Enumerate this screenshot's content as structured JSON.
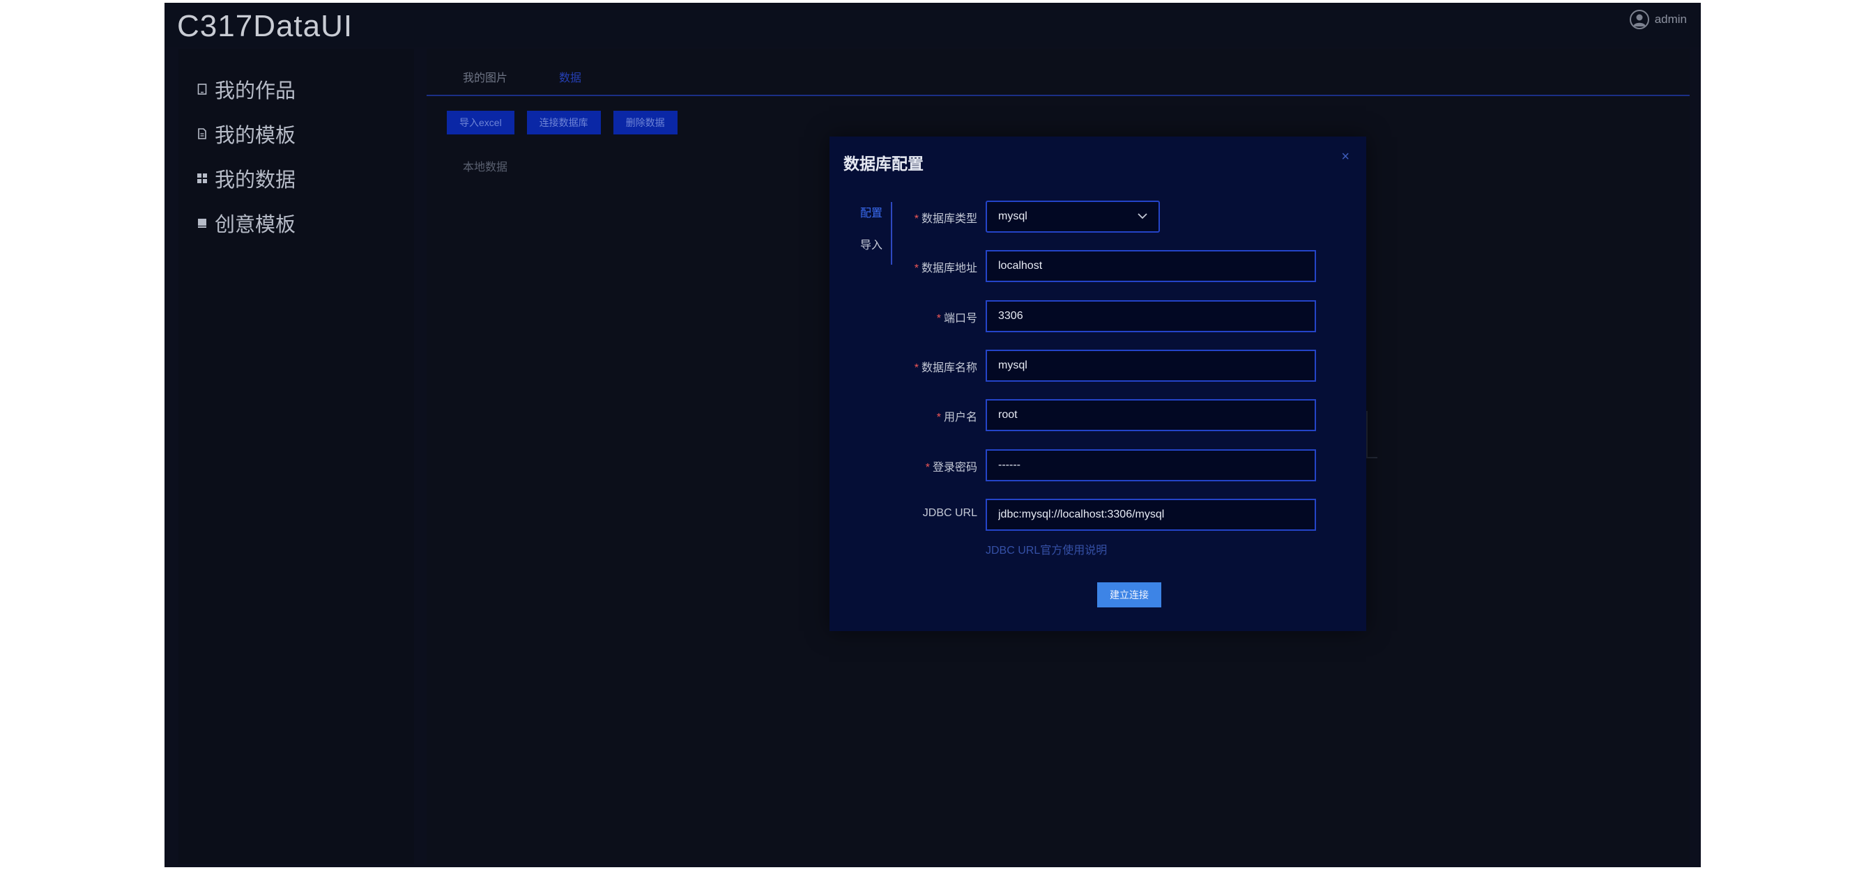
{
  "app": {
    "title": "C317DataUI",
    "user_name": "admin"
  },
  "sidebar": {
    "items": [
      {
        "label": "我的作品",
        "icon": "tablet-icon"
      },
      {
        "label": "我的模板",
        "icon": "document-icon"
      },
      {
        "label": "我的数据",
        "icon": "grid-icon"
      },
      {
        "label": "创意模板",
        "icon": "square-icon"
      }
    ]
  },
  "main": {
    "tabs": [
      {
        "label": "我的图片"
      },
      {
        "label": "数据",
        "active": true
      }
    ],
    "toolbar": {
      "import_excel": "导入excel",
      "connect_db": "连接数据库",
      "delete_data": "删除数据"
    },
    "local_data_label": "本地数据"
  },
  "modal": {
    "title": "数据库配置",
    "close": "×",
    "side_tabs": [
      {
        "label": "配置",
        "active": true
      },
      {
        "label": "导入"
      }
    ],
    "fields": {
      "db_type": {
        "label": "数据库类型",
        "value": "mysql"
      },
      "db_address": {
        "label": "数据库地址",
        "value": "localhost"
      },
      "port": {
        "label": "端口号",
        "value": "3306"
      },
      "db_name": {
        "label": "数据库名称",
        "value": "mysql"
      },
      "username": {
        "label": "用户名",
        "value": "root"
      },
      "password": {
        "label": "登录密码",
        "value": "------"
      },
      "jdbc_url": {
        "label": "JDBC URL",
        "value": "jdbc:mysql://localhost:3306/mysql"
      }
    },
    "required_mark": "*",
    "hint": "JDBC URL官方使用说明",
    "submit_label": "建立连接"
  },
  "colors": {
    "background": "#0c0f1d",
    "modal_bg": "#050e36",
    "accent": "#2444c8",
    "primary_button": "#0a27a6",
    "submit_button": "#3d84e6",
    "required": "#f05656"
  }
}
